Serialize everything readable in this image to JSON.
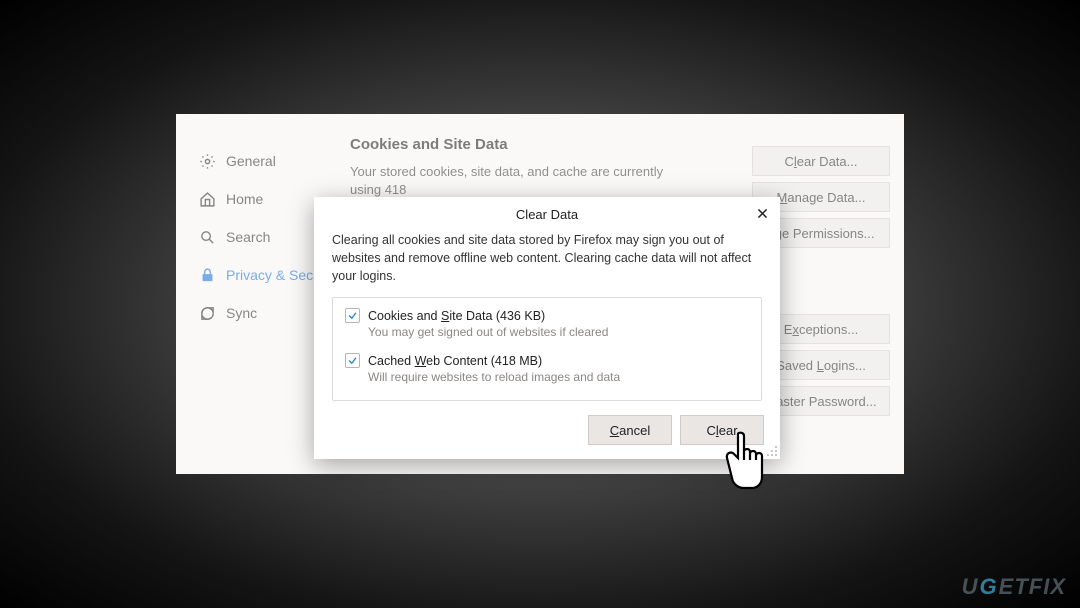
{
  "sidebar": {
    "items": [
      {
        "label": "General"
      },
      {
        "label": "Home"
      },
      {
        "label": "Search"
      },
      {
        "label": "Privacy & Sec"
      },
      {
        "label": "Sync"
      }
    ]
  },
  "main": {
    "heading": "Cookies and Site Data",
    "desc": "Your stored cookies, site data, and cache are currently using 418"
  },
  "buttons": {
    "clear_data": "Clear Data...",
    "manage_data": "Manage Data...",
    "permissions": "age Permissions...",
    "exceptions": "Exceptions...",
    "saved_logins": "Saved Logins...",
    "master_pw": "Master Password..."
  },
  "dialog": {
    "title": "Clear Data",
    "message": "Clearing all cookies and site data stored by Firefox may sign you out of websites and remove offline web content. Clearing cache data will not affect your logins.",
    "opt1": {
      "label": "Cookies and Site Data (436 KB)",
      "sub": "You may get signed out of websites if cleared"
    },
    "opt2": {
      "label": "Cached Web Content (418 MB)",
      "sub": "Will require websites to reload images and data"
    },
    "cancel": "Cancel",
    "clear": "Clear"
  },
  "watermark": "UGETFIX"
}
